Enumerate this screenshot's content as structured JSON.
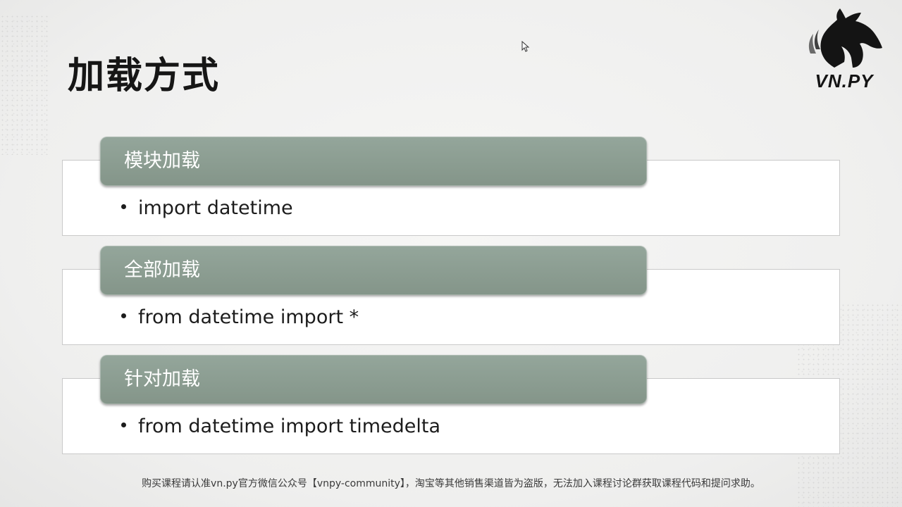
{
  "slide": {
    "title": "加载方式",
    "logo_text": "VN.PY",
    "blocks": [
      {
        "header": "模块加载",
        "item": "import datetime"
      },
      {
        "header": "全部加载",
        "item": "from datetime import *"
      },
      {
        "header": "针对加载",
        "item": "from datetime import timedelta"
      }
    ],
    "footer": "购买课程请认准vn.py官方微信公众号【vnpy-community】，淘宝等其他销售渠道皆为盗版，无法加入课程讨论群获取课程代码和提问求助。"
  },
  "colors": {
    "header_fill": "#8c9d92",
    "title_text": "#161616",
    "body_border": "#c9c9c9"
  }
}
